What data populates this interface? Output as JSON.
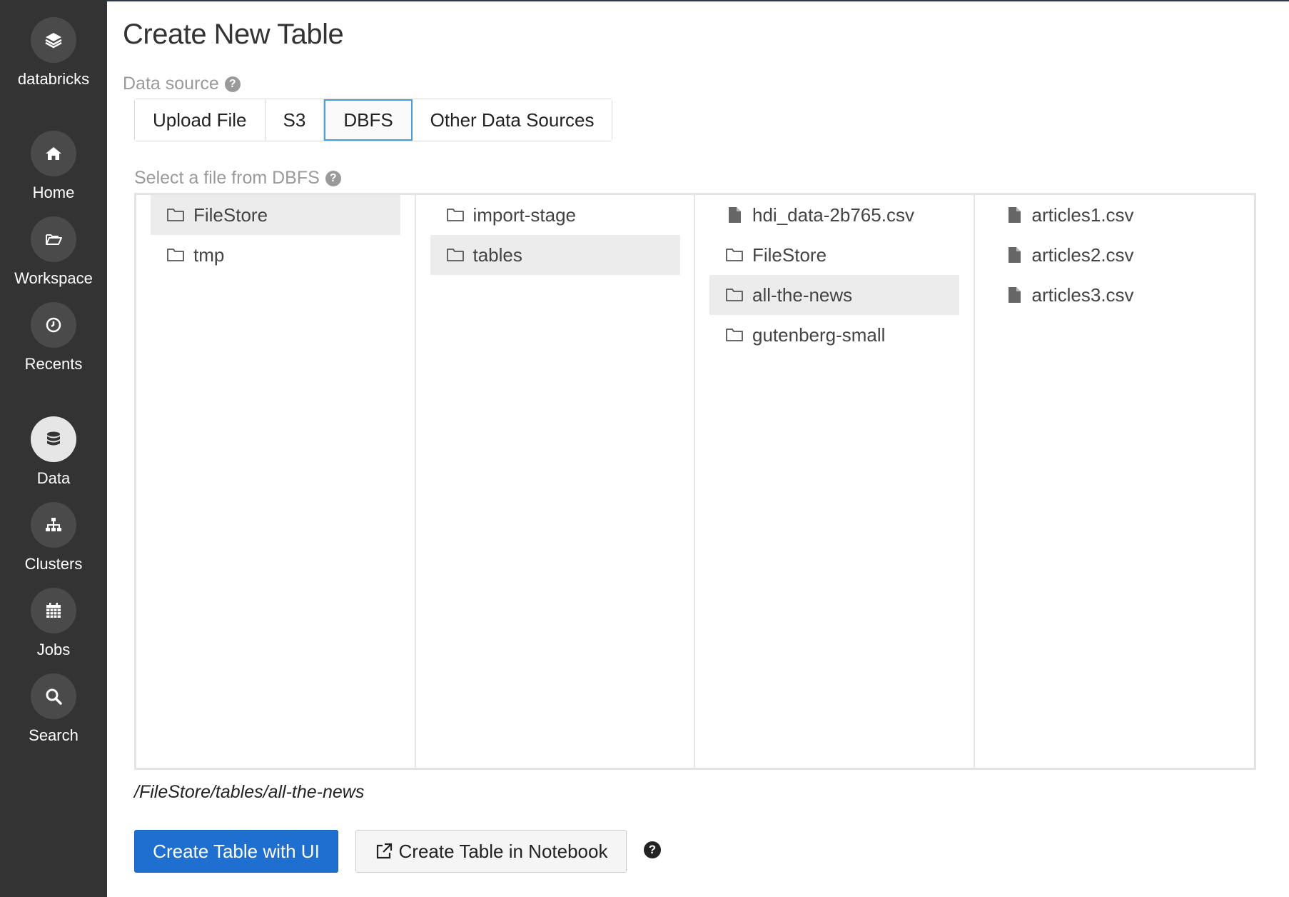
{
  "sidebar": {
    "items": [
      {
        "label": "databricks",
        "icon": "databricks-logo-icon",
        "active": false
      },
      {
        "label": "Home",
        "icon": "home-icon",
        "active": false
      },
      {
        "label": "Workspace",
        "icon": "folder-open-icon",
        "active": false
      },
      {
        "label": "Recents",
        "icon": "clock-icon",
        "active": false
      },
      {
        "label": "Data",
        "icon": "database-icon",
        "active": true
      },
      {
        "label": "Clusters",
        "icon": "cluster-icon",
        "active": false
      },
      {
        "label": "Jobs",
        "icon": "calendar-icon",
        "active": false
      },
      {
        "label": "Search",
        "icon": "search-icon",
        "active": false
      }
    ]
  },
  "page": {
    "title": "Create New Table",
    "data_source_label": "Data source",
    "tabs": [
      "Upload File",
      "S3",
      "DBFS",
      "Other Data Sources"
    ],
    "active_tab": "DBFS",
    "select_label": "Select a file from DBFS"
  },
  "browser": {
    "columns": [
      [
        {
          "name": "FileStore",
          "type": "folder",
          "selected": true
        },
        {
          "name": "tmp",
          "type": "folder",
          "selected": false
        }
      ],
      [
        {
          "name": "import-stage",
          "type": "folder",
          "selected": false
        },
        {
          "name": "tables",
          "type": "folder",
          "selected": true
        }
      ],
      [
        {
          "name": "hdi_data-2b765.csv",
          "type": "file",
          "selected": false
        },
        {
          "name": "FileStore",
          "type": "folder",
          "selected": false
        },
        {
          "name": "all-the-news",
          "type": "folder",
          "selected": true
        },
        {
          "name": "gutenberg-small",
          "type": "folder",
          "selected": false
        }
      ],
      [
        {
          "name": "articles1.csv",
          "type": "file",
          "selected": false
        },
        {
          "name": "articles2.csv",
          "type": "file",
          "selected": false
        },
        {
          "name": "articles3.csv",
          "type": "file",
          "selected": false
        }
      ]
    ]
  },
  "path": "/FileStore/tables/all-the-news",
  "actions": {
    "create_ui": "Create Table with UI",
    "create_notebook": "Create Table in Notebook"
  },
  "colors": {
    "sidebar": "#333333",
    "primary": "#1e6fd0",
    "tab_active_border": "#4a9fd8",
    "selected_row": "#ececec"
  }
}
